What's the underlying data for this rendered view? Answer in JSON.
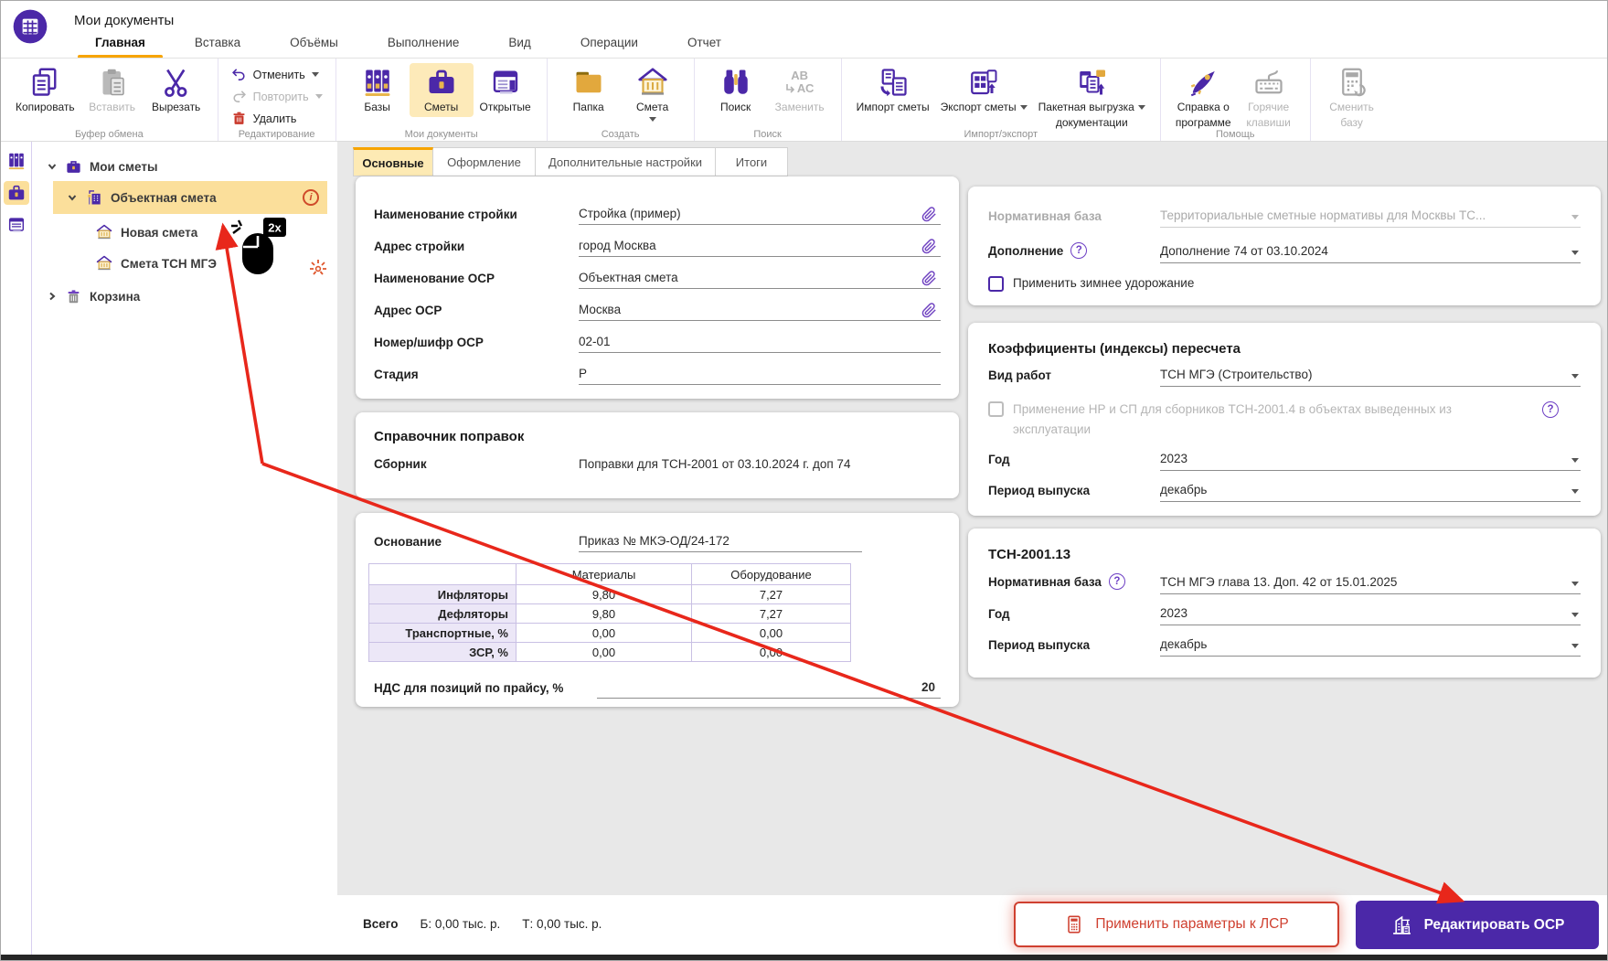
{
  "header": {
    "title": "Мои документы",
    "tabs": [
      "Главная",
      "Вставка",
      "Объёмы",
      "Выполнение",
      "Вид",
      "Операции",
      "Отчет"
    ]
  },
  "toolbar": {
    "copy": "Копировать",
    "paste": "Вставить",
    "cut": "Вырезать",
    "undo": "Отменить",
    "redo": "Повторить",
    "remove": "Удалить",
    "bases": "Базы",
    "estimates": "Сметы",
    "opened": "Открытые",
    "folder": "Папка",
    "estimate": "Смета",
    "find": "Поиск",
    "replace": "Заменить",
    "replace_glyph_top": "АВ",
    "replace_glyph_bottom": "АС",
    "import": "Импорт сметы",
    "export": "Экспорт сметы",
    "batch_line1": "Пакетная выгрузка",
    "batch_line2": "документации",
    "about_line1": "Справка о",
    "about_line2": "программе",
    "hotkeys_line1": "Горячие",
    "hotkeys_line2": "клавиши",
    "change_line1": "Сменить",
    "change_line2": "базу",
    "groups": {
      "clipboard": "Буфер обмена",
      "editing": "Редактирование",
      "mydocs": "Мои документы",
      "create": "Создать",
      "find": "Поиск",
      "importexport": "Импорт/экспорт",
      "help": "Помощь"
    }
  },
  "tree": {
    "root": "Мои сметы",
    "selected": "Объектная смета",
    "child1": "Новая смета",
    "child2": "Смета ТСН МГЭ",
    "trash": "Корзина",
    "dblclick_badge": "2x",
    "info_glyph": "i"
  },
  "tabs": {
    "main": "Основные",
    "design": "Оформление",
    "advanced": "Дополнительные настройки",
    "totals": "Итоги"
  },
  "form": {
    "rows": [
      {
        "label": "Наименование стройки",
        "value": "Стройка (пример)"
      },
      {
        "label": "Адрес стройки",
        "value": "город Москва"
      },
      {
        "label": "Наименование ОСР",
        "value": "Объектная смета"
      },
      {
        "label": "Адрес ОСР",
        "value": "Москва"
      },
      {
        "label": "Номер/шифр ОСР",
        "value": "02-01"
      },
      {
        "label": "Стадия",
        "value": "Р"
      }
    ]
  },
  "corrections": {
    "title": "Справочник поправок",
    "label": "Сборник",
    "value": "Поправки для ТСН-2001 от 03.10.2024 г. доп 74"
  },
  "basis": {
    "label": "Основание",
    "value": "Приказ № МКЭ-ОД/24-172",
    "table": {
      "col1": "Материалы",
      "col2": "Оборудование",
      "rows": [
        {
          "label": "Инфляторы",
          "v1": "9,80",
          "v2": "7,27"
        },
        {
          "label": "Дефляторы",
          "v1": "9,80",
          "v2": "7,27"
        },
        {
          "label": "Транспортные, %",
          "v1": "0,00",
          "v2": "0,00"
        },
        {
          "label": "ЗСР, %",
          "v1": "0,00",
          "v2": "0,00"
        }
      ]
    },
    "vat_label": "НДС для позиций по прайсу, %",
    "vat_value": "20"
  },
  "right": {
    "normative_label": "Нормативная база",
    "normative_value": "Территориальные сметные нормативы для Москвы ТС...",
    "addition_label": "Дополнение",
    "addition_value": "Дополнение 74 от 03.10.2024",
    "winter_label": "Применить зимнее удорожание",
    "coeff_title": "Коэффициенты (индексы) пересчета",
    "worktype_label": "Вид работ",
    "worktype_value": "ТСН МГЭ (Строительство)",
    "nr_label": "Применение НР и СП для сборников ТСН-2001.4 в объектах выведенных из эксплуатации",
    "year_label": "Год",
    "year_value": "2023",
    "period_label": "Период выпуска",
    "period_value": "декабрь",
    "tsn_title": "ТСН-2001.13",
    "tsn_norm_label": "Нормативная база",
    "tsn_norm_value": "ТСН МГЭ глава 13. Доп. 42 от 15.01.2025",
    "tsn_year_label": "Год",
    "tsn_year_value": "2023",
    "tsn_period_label": "Период выпуска",
    "tsn_period_value": "декабрь",
    "help_glyph": "?"
  },
  "footer": {
    "total_label": "Всего",
    "base_total": "Б: 0,00 тыс. р.",
    "current_total": "Т: 0,00 тыс. р.",
    "apply": "Применить параметры к ЛСР",
    "edit": "Редактировать ОСР"
  },
  "colors": {
    "purple": "#4b28a8",
    "orange": "#f7a400",
    "selected_yellow": "#fbdf9b",
    "tab_yellow": "#fdeab4",
    "red": "#e8271b"
  }
}
